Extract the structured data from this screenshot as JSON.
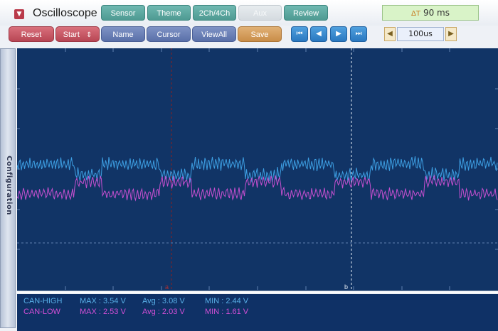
{
  "app": {
    "title": "Oscilloscope",
    "menu_icon": "▼"
  },
  "tabs": [
    {
      "label": "Sensor"
    },
    {
      "label": "Theme"
    },
    {
      "label": "2Ch/4Ch"
    },
    {
      "label": "Aux"
    },
    {
      "label": "Review"
    }
  ],
  "time_readout": {
    "icon": "ΔT",
    "value": "90 ms"
  },
  "toolbar": {
    "reset": "Reset",
    "start": "Start",
    "start_arrow": "⇕",
    "name": "Name",
    "cursor": "Cursor",
    "viewall": "ViewAll",
    "save": "Save"
  },
  "playback": {
    "first": "⏮",
    "prev": "◀",
    "next": "▶",
    "last": "⏭"
  },
  "timebase": {
    "dec": "◀",
    "value": "100us",
    "inc": "▶"
  },
  "sidebar": {
    "label": "Configuration"
  },
  "scope": {
    "cursor_a_label": "a",
    "cursor_b_label": "b",
    "colors": {
      "background": "#113466",
      "ch1": "#3d9ee2",
      "ch2": "#c64fd0",
      "cursor_a": "#8a2020",
      "grid": "#5f80b0"
    }
  },
  "channels": [
    {
      "name": "CAN-HIGH",
      "max": "MAX : 3.54 V",
      "avg": "Avg : 3.08 V",
      "min": "MIN : 2.44 V"
    },
    {
      "name": "CAN-LOW",
      "max": "MAX : 2.53 V",
      "avg": "Avg : 2.03 V",
      "min": "MIN : 1.61 V"
    }
  ]
}
